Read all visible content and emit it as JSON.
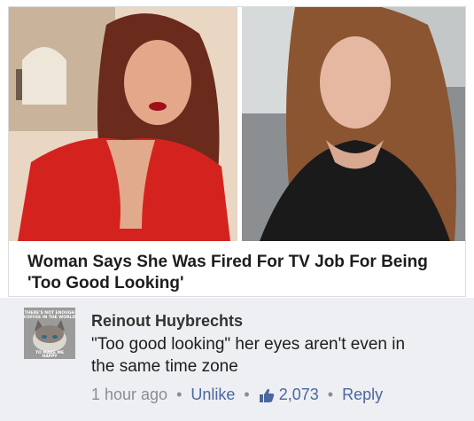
{
  "article": {
    "headline_line1": "Woman Says She Was Fired For TV Job For Being",
    "headline_line2": "'Too Good Looking'",
    "photos": [
      "woman-in-red-dress-photo",
      "woman-in-car-selfie-photo"
    ]
  },
  "comment": {
    "avatar_caption_top": "THERE'S NOT ENOUGH COFFEE IN THE WORLD",
    "avatar_caption_bottom": "TO MAKE ME HAPPY",
    "author": "Reinout Huybrechts",
    "text_line1": "\"Too good looking\" her eyes aren't even in",
    "text_line2": "the same time zone",
    "timestamp": "1 hour ago",
    "unlike_label": "Unlike",
    "like_count": "2,073",
    "reply_label": "Reply",
    "separator": "•"
  },
  "colors": {
    "link": "#4b67a1",
    "meta_gray": "#8a8d91",
    "comment_bg": "#eeeff2",
    "dress_red": "#d4231f"
  }
}
